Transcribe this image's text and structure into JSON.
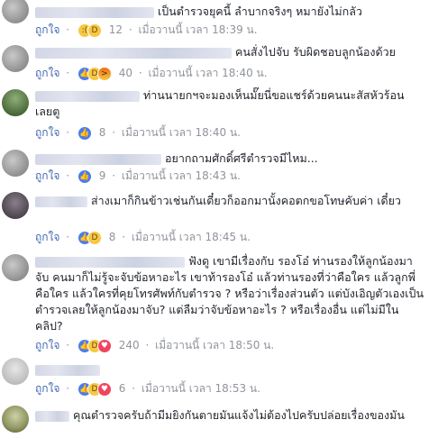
{
  "comments": [
    {
      "text": "เป็นตำรวจยุคนี้ ลำบากจริงๆ หมายังไม่กลัว",
      "like": "ถูกใจ",
      "count": "12",
      "time": "เมื่อวานนี้ เวลา 18:39 น.",
      "reactions": [
        "sad-icon",
        "haha-icon"
      ]
    },
    {
      "text": "คนสั่งไปจับ รับผิดชอบลูกน้องด้วย",
      "like": "ถูกใจ",
      "count": "40",
      "time": "เมื่อวานนี้ เวลา 18:40 น.",
      "reactions": [
        "like-icon",
        "haha-icon",
        "angry-icon"
      ]
    },
    {
      "text": "ท่านนายกฯจะมองเห็นมั๊ยนี่ขอแชร์ด้วยคนนะสัสหัวร้อน เลยตู",
      "like": "ถูกใจ",
      "count": "8",
      "time": "เมื่อวานนี้ เวลา 18:40 น.",
      "reactions": [
        "like-icon"
      ]
    },
    {
      "text": "อยากถามศักดิ์ศรีตำรวจมีไหม...",
      "like": "ถูกใจ",
      "count": "9",
      "time": "เมื่อวานนี้ เวลา 18:43 น.",
      "reactions": [
        "like-icon"
      ]
    },
    {
      "text": "ส่างเมาก็กินข้าวเช่นกันเดี๋ยวก็ออกมานั้งคอตกขอโทษคับค่า เดี๋ยว",
      "like": "ถูกใจ",
      "count": "8",
      "time": "เมื่อวานนี้ เวลา 18:45 น.",
      "reactions": [
        "like-icon",
        "haha-icon"
      ]
    },
    {
      "text": "ฟังดู เขามีเรื่องกับ รองโอ๋ ท่านรองให้ลูกน้องมาจับ คนมาก็ไม่รู้จะจับข้อหาอะไร เขาท้ารองโอ๋ แล้วท่านรองที่ว่าคือใคร แล้วลูกพี่ คือใคร แล้วใครที่คุยโทรศัพท์กับตำรวจ ? หรือว่าเรื่องส่วนตัว แต่บังเอิญตัวเองเป็นตำรวจเลยให้ลูกน้องมาจับ? แต่ลืมว่าจับข้อหาอะไร ? หรือเรื่องอื่น แต่ไม่มีในคลิป?",
      "like": "ถูกใจ",
      "count": "240",
      "time": "เมื่อวานนี้ เวลา 18:50 น.",
      "reactions": [
        "like-icon",
        "haha-icon",
        "love-icon"
      ]
    },
    {
      "text": "",
      "like": "ถูกใจ",
      "count": "6",
      "time": "เมื่อวานนี้ เวลา 18:53 น.",
      "reactions": [
        "like-icon",
        "haha-icon",
        "love-icon"
      ]
    },
    {
      "text": "คุณตำรวจครับถ้ามีมยิงกันตายมันแจ้งไม่ต้องไปครับปล่อยเรื่องของมัน",
      "like": "",
      "count": "",
      "time": "",
      "reactions": []
    }
  ],
  "sep": "·",
  "colors": {
    "link": "#4267b2",
    "meta": "#90949c",
    "text": "#1d2129"
  }
}
